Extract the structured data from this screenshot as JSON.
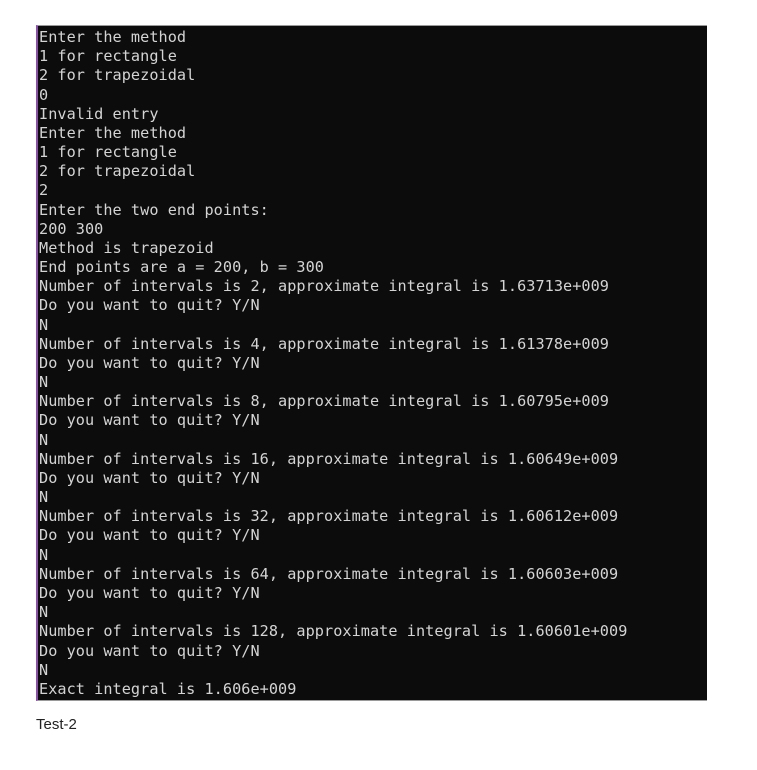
{
  "console": {
    "lines": [
      "Enter the method",
      "1 for rectangle",
      "2 for trapezoidal",
      "0",
      "Invalid entry",
      "Enter the method",
      "1 for rectangle",
      "2 for trapezoidal",
      "2",
      "Enter the two end points:",
      "200 300",
      "Method is trapezoid",
      "End points are a = 200, b = 300",
      "Number of intervals is 2, approximate integral is 1.63713e+009",
      "Do you want to quit? Y/N",
      "N",
      "Number of intervals is 4, approximate integral is 1.61378e+009",
      "Do you want to quit? Y/N",
      "N",
      "Number of intervals is 8, approximate integral is 1.60795e+009",
      "Do you want to quit? Y/N",
      "N",
      "Number of intervals is 16, approximate integral is 1.60649e+009",
      "Do you want to quit? Y/N",
      "N",
      "Number of intervals is 32, approximate integral is 1.60612e+009",
      "Do you want to quit? Y/N",
      "N",
      "Number of intervals is 64, approximate integral is 1.60603e+009",
      "Do you want to quit? Y/N",
      "N",
      "Number of intervals is 128, approximate integral is 1.60601e+009",
      "Do you want to quit? Y/N",
      "N",
      "Exact integral is 1.606e+009"
    ]
  },
  "caption": "Test-2"
}
